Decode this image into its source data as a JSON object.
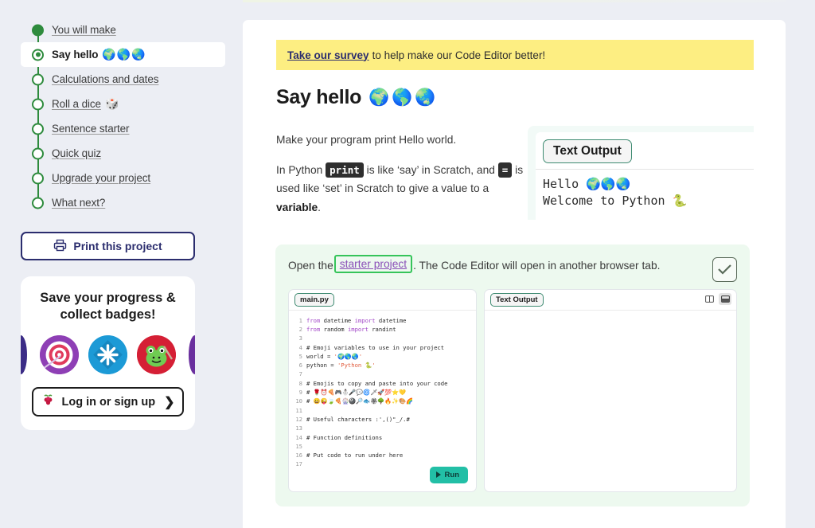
{
  "sidebar": {
    "steps": [
      {
        "label": "You will make",
        "emoji": "",
        "state": "done"
      },
      {
        "label": "Say hello",
        "emoji": "🌍🌎🌏",
        "state": "current"
      },
      {
        "label": "Calculations and dates",
        "emoji": "",
        "state": "todo"
      },
      {
        "label": "Roll a dice",
        "emoji": "🎲",
        "state": "todo"
      },
      {
        "label": "Sentence starter",
        "emoji": "",
        "state": "todo"
      },
      {
        "label": "Quick quiz",
        "emoji": "",
        "state": "todo"
      },
      {
        "label": "Upgrade your project",
        "emoji": "",
        "state": "todo"
      },
      {
        "label": "What next?",
        "emoji": "",
        "state": "todo"
      }
    ],
    "print_button": "Print this project",
    "badge_card": {
      "title_line1": "Save your progress &",
      "title_line2": "collect badges!",
      "badges": [
        {
          "name": "target-badge",
          "glyph": "🎯",
          "color": "#8e3fb5"
        },
        {
          "name": "snowflake-badge",
          "glyph": "❄",
          "color": "#1c9ad6"
        },
        {
          "name": "frog-badge",
          "glyph": "🐸",
          "color": "#d51f35"
        }
      ],
      "login_label": "Log in or sign up",
      "login_icon": "🍓",
      "chevron": "❯"
    }
  },
  "main": {
    "survey": {
      "link": "Take our survey",
      "text": "to help make our Code Editor better!"
    },
    "title": "Say hello",
    "title_emoji": "🌍🌎🌏",
    "paragraph1": "Make your program print Hello world.",
    "p2_part1": "In Python",
    "p2_code1": "print",
    "p2_part2": "is like ‘say’ in Scratch, and",
    "p2_code2": "=",
    "p2_part3": "is used like ‘set’ in Scratch to give a value to a",
    "p2_bold": "variable",
    "p2_end": ".",
    "output_preview": {
      "tab_label": "Text Output",
      "line1": "Hello 🌍🌎🌏",
      "line2": "Welcome to Python 🐍"
    },
    "task": {
      "lead": "Open the",
      "link": "starter project",
      "rest": ". The Code Editor will open in another browser tab.",
      "checkbox_checked": true
    },
    "editor": {
      "file_tab": "main.py",
      "output_tab": "Text Output",
      "run_label": "Run",
      "code_lines": [
        {
          "n": "1",
          "text": "from datetime import datetime"
        },
        {
          "n": "2",
          "text": "from random import randint"
        },
        {
          "n": "3",
          "text": ""
        },
        {
          "n": "4",
          "text": "# Emoji variables to use in your project"
        },
        {
          "n": "5",
          "text": "world = '🌍🌎🌏'"
        },
        {
          "n": "6",
          "text": "python = 'Python 🐍'"
        },
        {
          "n": "7",
          "text": ""
        },
        {
          "n": "8",
          "text": "# Emojis to copy and paste into your code"
        },
        {
          "n": "9",
          "text": "# 🌹⏰🍕🎮⛄🎤💬🌀🗡🚀💯⭐💛"
        },
        {
          "n": "10",
          "text": "# 😀😜🍃🍕🎡🎱🔎🐟🏵🌳🔥✨🎨🌈"
        },
        {
          "n": "11",
          "text": ""
        },
        {
          "n": "12",
          "text": "# Useful characters :',()\"_/.#"
        },
        {
          "n": "13",
          "text": ""
        },
        {
          "n": "14",
          "text": "# Function definitions"
        },
        {
          "n": "15",
          "text": ""
        },
        {
          "n": "16",
          "text": "# Put code to run under here"
        },
        {
          "n": "17",
          "text": ""
        }
      ]
    }
  },
  "colors": {
    "page_bg": "#eceef4",
    "rail_green": "#2e8b3d",
    "banner_yellow": "#fdee82",
    "task_panel_green": "#edf9ef",
    "link_purple": "#8a4fb8",
    "focus_green": "#35c45a",
    "run_teal": "#22bfa6",
    "navy": "#2b2d6e"
  }
}
